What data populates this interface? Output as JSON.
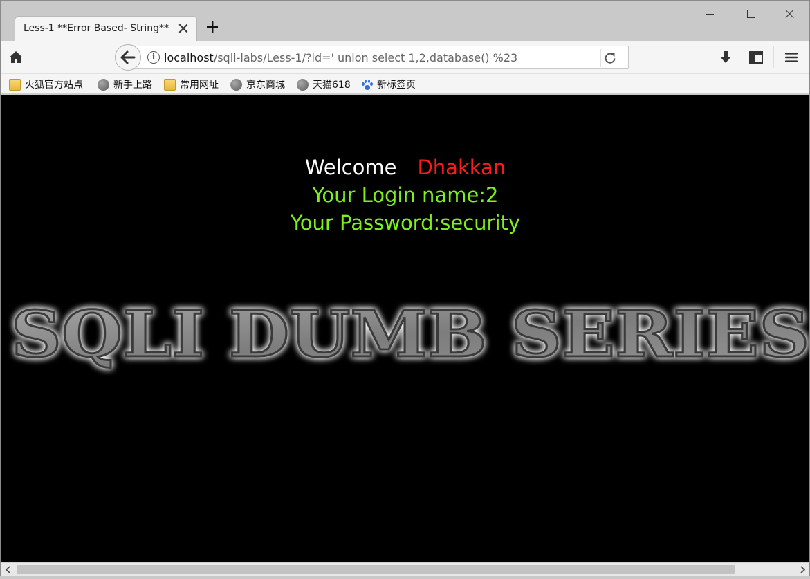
{
  "browser": {
    "tab": {
      "title": "Less-1 **Error Based- String**"
    },
    "url": {
      "host": "localhost",
      "path": "/sqli-labs/Less-1/?id=' union select 1,2,database() %23"
    },
    "bookmarks": [
      {
        "label": "火狐官方站点",
        "icon": "folder-icon"
      },
      {
        "label": "新手上路",
        "icon": "globe-icon"
      },
      {
        "label": "常用网址",
        "icon": "folder-icon"
      },
      {
        "label": "京东商城",
        "icon": "globe-icon"
      },
      {
        "label": "天猫618",
        "icon": "globe-icon"
      },
      {
        "label": "新标签页",
        "icon": "baidu-paw-icon"
      }
    ]
  },
  "page": {
    "welcome_label": "Welcome",
    "welcome_name": "Dhakkan",
    "login_line": "Your Login name:2",
    "password_line": "Your Password:security",
    "banner_text": "SQLI DUMB SERIES-"
  },
  "colors": {
    "page_background": "#000000",
    "welcome_name": "#ff1a1a",
    "result_text": "#7cf21a",
    "banner_fill": "#8c8c8c",
    "banner_glow": "#ffffff"
  }
}
